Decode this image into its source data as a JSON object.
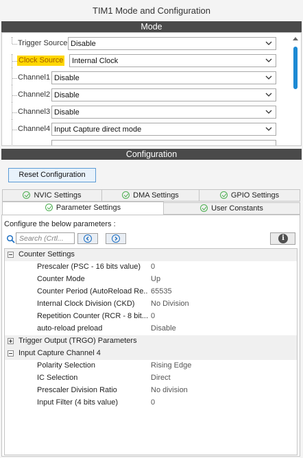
{
  "window": {
    "title": "TIM1 Mode and Configuration"
  },
  "mode": {
    "header": "Mode",
    "rows": [
      {
        "label": "Trigger Source",
        "value": "Disable",
        "highlight": false
      },
      {
        "label": "Clock Source",
        "value": "Internal Clock",
        "highlight": true
      },
      {
        "label": "Channel1",
        "value": "Disable",
        "highlight": false
      },
      {
        "label": "Channel2",
        "value": "Disable",
        "highlight": false
      },
      {
        "label": "Channel3",
        "value": "Disable",
        "highlight": false
      },
      {
        "label": "Channel4",
        "value": "Input Capture direct mode",
        "highlight": false
      }
    ]
  },
  "config": {
    "header": "Configuration",
    "reset_label": "Reset Configuration",
    "tabs_row1": [
      "NVIC Settings",
      "DMA Settings",
      "GPIO Settings"
    ],
    "tabs_row2": [
      "Parameter Settings",
      "User Constants"
    ],
    "active_tab": "Parameter Settings",
    "hint": "Configure the below parameters :",
    "search": {
      "placeholder": "Search (Crtl..."
    },
    "info_label": "i"
  },
  "params": {
    "counter": {
      "title": "Counter Settings",
      "expanded": true,
      "rows": [
        {
          "name": "Prescaler (PSC - 16 bits value)",
          "value": "0"
        },
        {
          "name": "Counter Mode",
          "value": "Up"
        },
        {
          "name": "Counter Period (AutoReload Re...",
          "value": "65535"
        },
        {
          "name": "Internal Clock Division (CKD)",
          "value": "No Division"
        },
        {
          "name": "Repetition Counter (RCR - 8 bit...",
          "value": "0"
        },
        {
          "name": "auto-reload preload",
          "value": "Disable"
        }
      ]
    },
    "trgo": {
      "title": "Trigger Output (TRGO) Parameters",
      "expanded": false
    },
    "ic4": {
      "title": "Input Capture Channel 4",
      "expanded": true,
      "rows": [
        {
          "name": "Polarity Selection",
          "value": "Rising Edge"
        },
        {
          "name": "IC Selection",
          "value": "Direct"
        },
        {
          "name": "Prescaler Division Ratio",
          "value": "No division"
        },
        {
          "name": "Input Filter (4 bits value)",
          "value": "0"
        }
      ]
    }
  },
  "colors": {
    "accent": "#1d8ad4",
    "highlight": "#ffd700",
    "check": "#4caf50",
    "header_bg": "#4a4a4a"
  }
}
